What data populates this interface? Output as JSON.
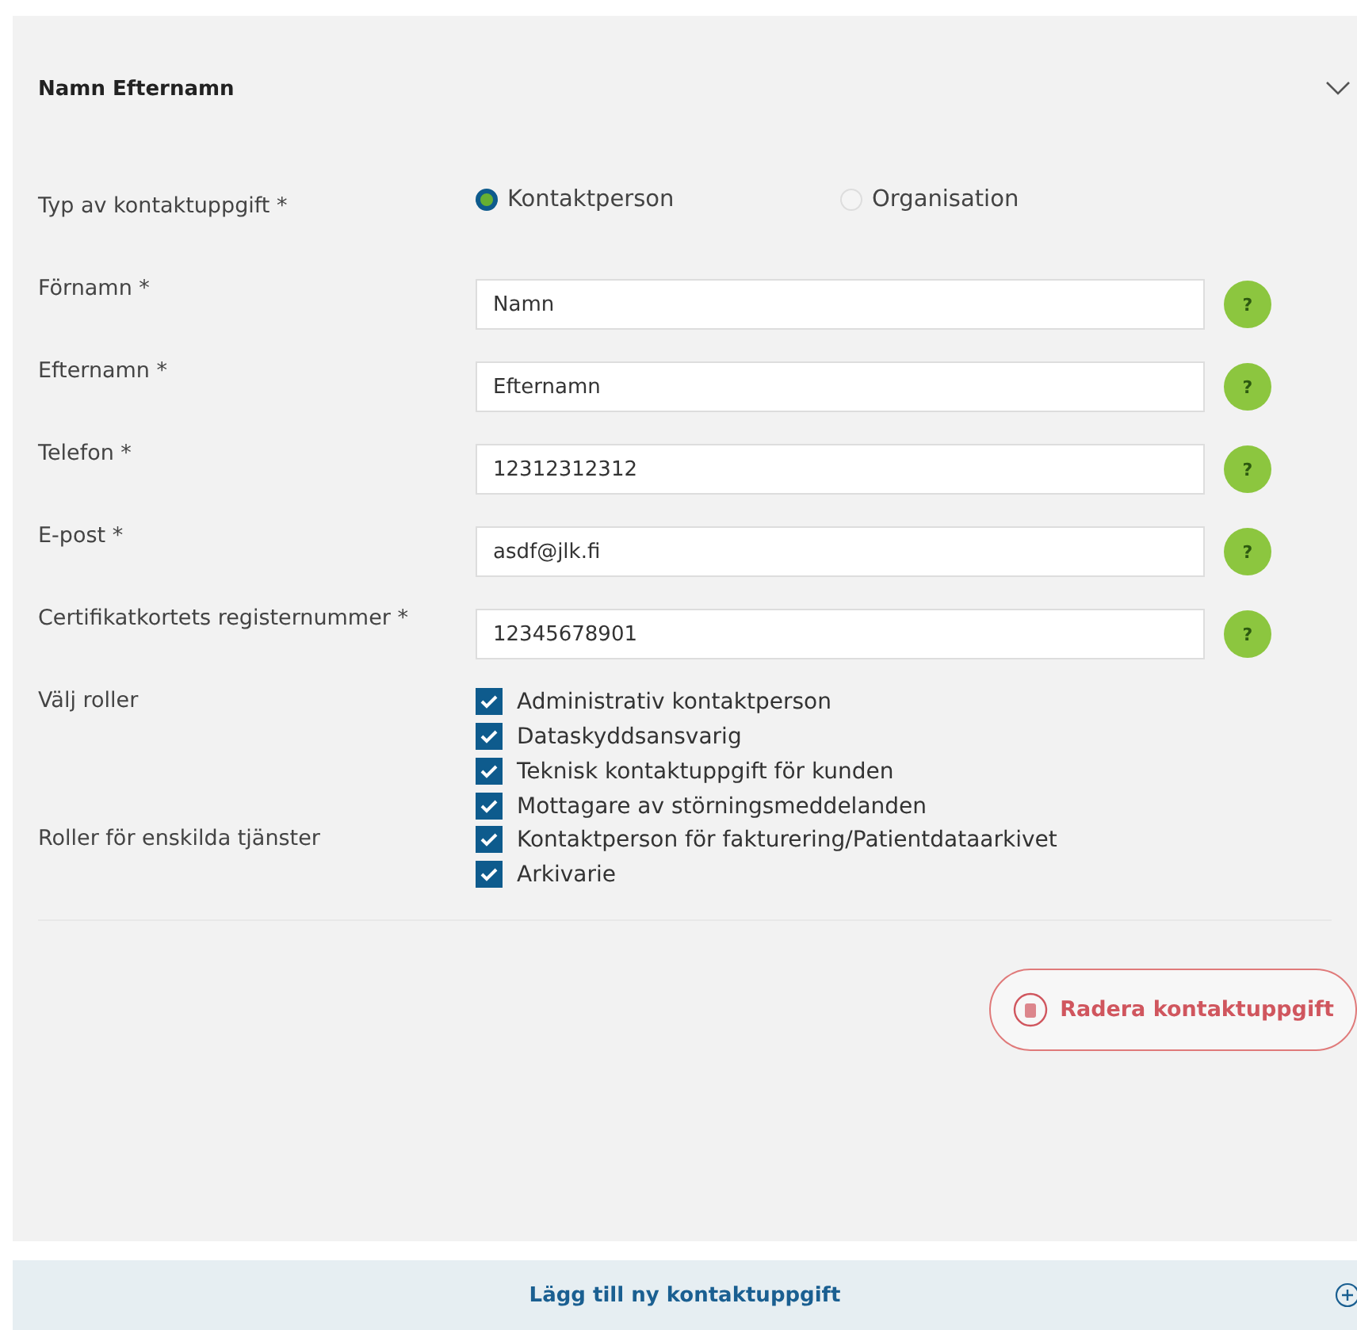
{
  "panel": {
    "title": "Namn Efternamn",
    "expanded": true
  },
  "contact_type": {
    "label": "Typ av kontaktuppgift  *",
    "options": [
      {
        "label": "Kontaktperson",
        "selected": true
      },
      {
        "label": "Organisation",
        "selected": false
      }
    ]
  },
  "fields": [
    {
      "label": "Förnamn *",
      "value": "Namn"
    },
    {
      "label": "Efternamn  *",
      "value": "Efternamn"
    },
    {
      "label": "Telefon *",
      "value": "12312312312"
    },
    {
      "label": "E-post *",
      "value": "asdf@jlk.fi"
    },
    {
      "label": "Certifikatkortets registernummer *",
      "value": "12345678901"
    }
  ],
  "help_symbol": "?",
  "role_groups": [
    {
      "label": "Välj roller",
      "roles": [
        {
          "label": "Administrativ kontaktperson",
          "checked": true
        },
        {
          "label": "Dataskyddsansvarig",
          "checked": true
        },
        {
          "label": "Teknisk kontaktuppgift för kunden",
          "checked": true
        },
        {
          "label": "Mottagare av störningsmeddelanden",
          "checked": true
        }
      ]
    },
    {
      "label": "Roller för enskilda tjänster",
      "roles": [
        {
          "label": "Kontaktperson för fakturering/Patientdataarkivet",
          "checked": true
        },
        {
          "label": "Arkivarie",
          "checked": true
        }
      ]
    }
  ],
  "delete_button": "Radera kontaktuppgift",
  "add_bar": "Lägg till ny kontaktuppgift"
}
